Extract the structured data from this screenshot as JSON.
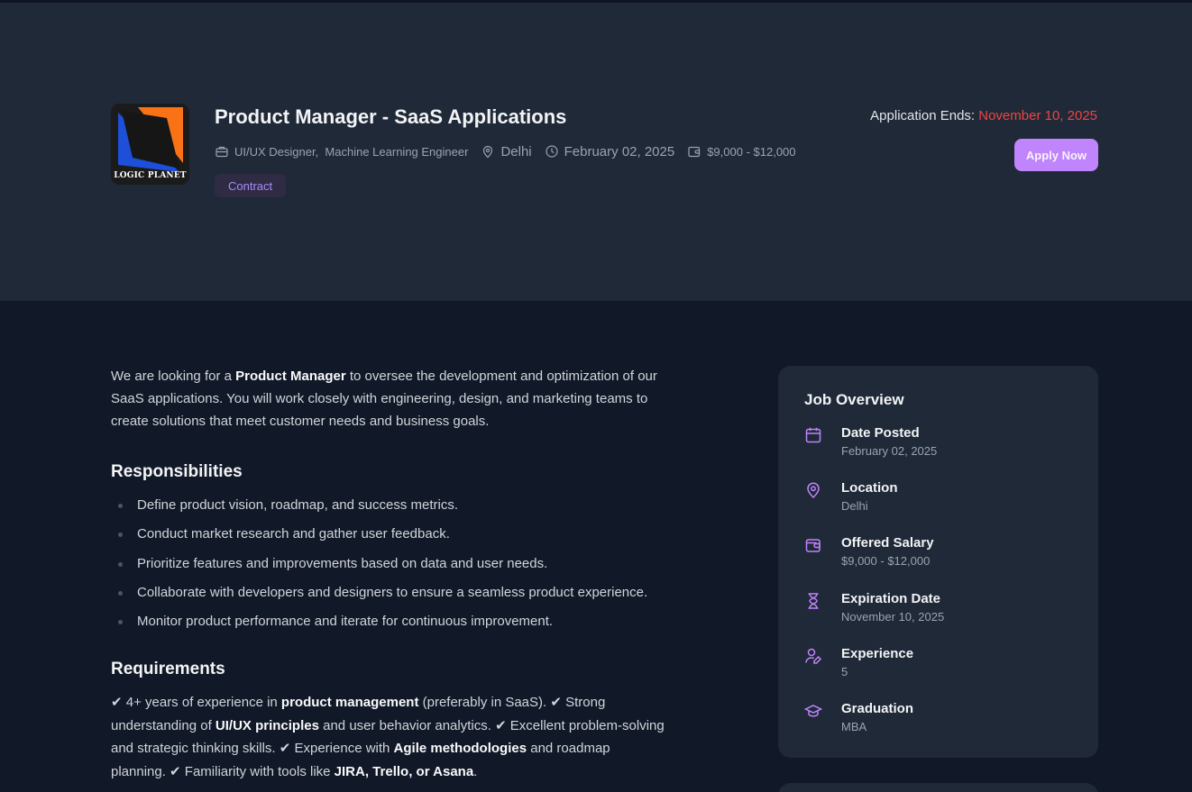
{
  "header": {
    "logo_text": "LOGIC PLANET",
    "title": "Product Manager - SaaS Applications",
    "categories": "UI/UX Designer,  Machine Learning Engineer",
    "location": "Delhi",
    "posted_date": "February 02, 2025",
    "salary": "$9,000 - $12,000",
    "job_type": "Contract",
    "ends_label": "Application Ends:",
    "ends_date": "November 10, 2025",
    "apply_label": "Apply Now"
  },
  "description": {
    "intro_1": "We are looking for a ",
    "intro_bold": "Product Manager",
    "intro_2": " to oversee the development and optimization of our SaaS applications. You will work closely with engineering, design, and marketing teams to create solutions that meet customer needs and business goals."
  },
  "responsibilities": {
    "title": "Responsibilities",
    "items": [
      "Define product vision, roadmap, and success metrics.",
      "Conduct market research and gather user feedback.",
      "Prioritize features and improvements based on data and user needs.",
      "Collaborate with developers and designers to ensure a seamless product experience.",
      "Monitor product performance and iterate for continuous improvement."
    ]
  },
  "requirements": {
    "title": "Requirements",
    "p1": "✔ 4+ years of experience in ",
    "b1": "product management",
    "p2": " (preferably in SaaS). ✔ Strong understanding of ",
    "b2": "UI/UX principles",
    "p3": " and user behavior analytics. ✔ Excellent problem-solving and strategic thinking skills. ✔ Experience with ",
    "b3": "Agile methodologies",
    "p4": " and roadmap planning. ✔ Familiarity with tools like ",
    "b4": "JIRA, Trello, or Asana",
    "p5": "."
  },
  "overview": {
    "title": "Job Overview",
    "accent_color": "#c084fc",
    "items": [
      {
        "label": "Date Posted",
        "value": "February 02, 2025",
        "icon": "calendar-icon"
      },
      {
        "label": "Location",
        "value": "Delhi",
        "icon": "map-pin-icon"
      },
      {
        "label": "Offered Salary",
        "value": "$9,000 - $12,000",
        "icon": "wallet-icon"
      },
      {
        "label": "Expiration Date",
        "value": "November 10, 2025",
        "icon": "hourglass-icon"
      },
      {
        "label": "Experience",
        "value": "5",
        "icon": "user-edit-icon"
      },
      {
        "label": "Graduation",
        "value": "MBA",
        "icon": "graduation-cap-icon"
      }
    ]
  }
}
